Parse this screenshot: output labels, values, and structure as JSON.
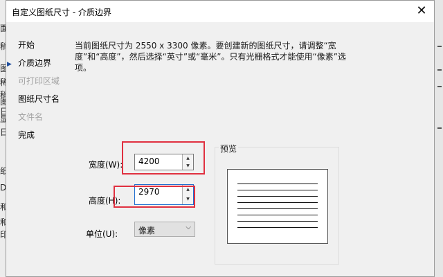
{
  "dialog": {
    "title": "自定义图纸尺寸 - 介质边界",
    "close_glyph": "✕"
  },
  "nav": {
    "items": [
      {
        "label": "开始",
        "state": "normal"
      },
      {
        "label": "介质边界",
        "state": "current"
      },
      {
        "label": "可打印区域",
        "state": "disabled"
      },
      {
        "label": "图纸尺寸名",
        "state": "normal"
      },
      {
        "label": "文件名",
        "state": "disabled"
      },
      {
        "label": "完成",
        "state": "normal"
      }
    ],
    "current_arrow": "▶"
  },
  "description": "当前图纸尺寸为 2550 x 3300 像素。要创建新的图纸尺寸，请调整“宽度”和“高度”，然后选择“英寸”或“毫米”。只有光栅格式才能使用“像素”选项。",
  "width": {
    "label": "宽度(W):",
    "value": "4200"
  },
  "height": {
    "label": "高度(H):",
    "value": "2970"
  },
  "unit": {
    "label": "单位(U):",
    "value": "像素",
    "options": [
      "像素"
    ]
  },
  "preview": {
    "title": "预览"
  },
  "colors": {
    "highlight": "#e03040",
    "nav_arrow": "#1f4e9e",
    "focus": "#1e6fd0"
  },
  "background_fragments": [
    "面",
    "稍",
    "图",
    "稀",
    "稍",
    "图",
    "日",
    "显",
    "日",
    "纸",
    "D",
    "和",
    "和",
    "印"
  ]
}
